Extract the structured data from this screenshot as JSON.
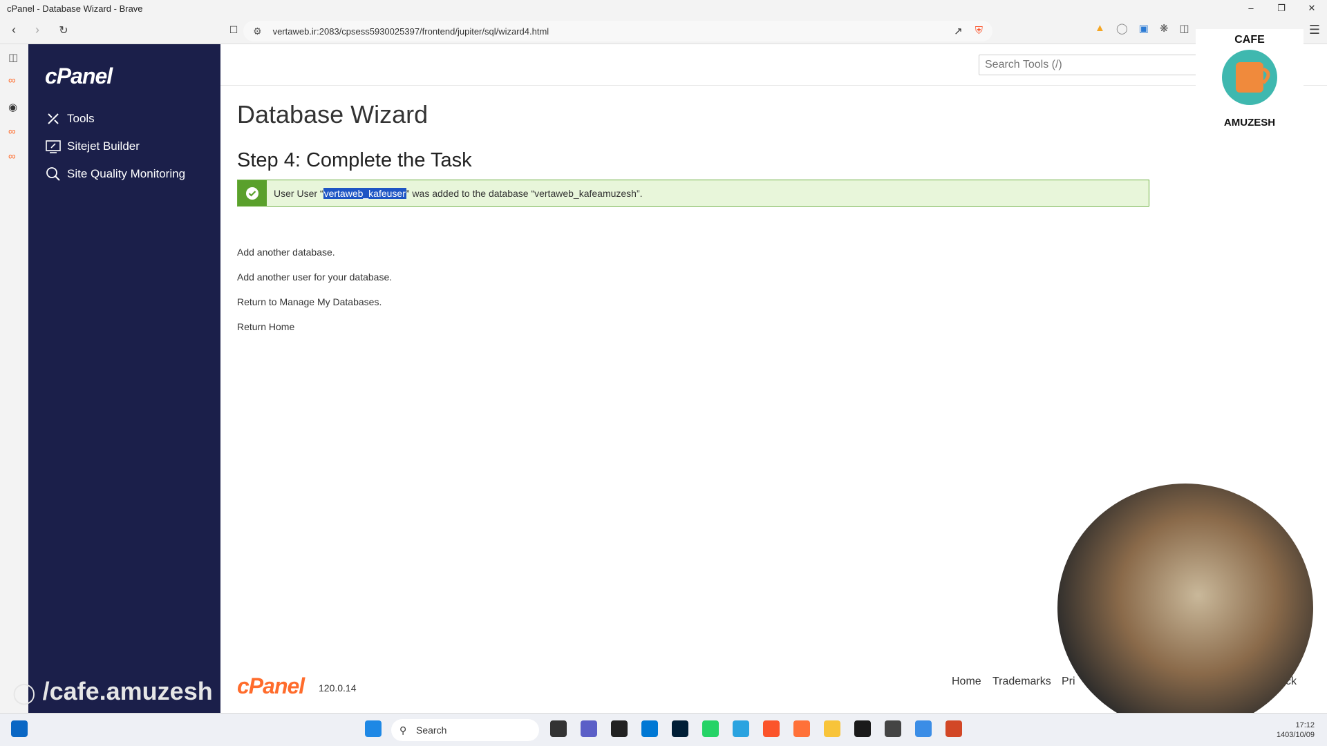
{
  "window": {
    "title": "cPanel - Database Wizard - Brave"
  },
  "browser": {
    "url": "vertaweb.ir:2083/cpsess5930025397/frontend/jupiter/sql/wizard4.html"
  },
  "sidebar": {
    "logo": "cPanel",
    "items": [
      {
        "label": "Tools",
        "icon": "tools-icon"
      },
      {
        "label": "Sitejet Builder",
        "icon": "sitejet-icon"
      },
      {
        "label": "Site Quality Monitoring",
        "icon": "magnifier-icon"
      }
    ]
  },
  "search": {
    "placeholder": "Search Tools (/)"
  },
  "main": {
    "title": "Database Wizard",
    "step_title": "Step 4: Complete the Task",
    "alert": {
      "prefix": "User “",
      "user": "vertaweb_kafeuser",
      "suffix": "” was added to the database “vertaweb_kafeamuzesh”."
    },
    "links": [
      "Add another database.",
      "Add another user for your database.",
      "Return to Manage My Databases.",
      "Return Home"
    ]
  },
  "footer": {
    "logo": "cPanel",
    "version": "120.0.14",
    "links": [
      "Home",
      "Trademarks",
      "Pri",
      "ck"
    ]
  },
  "overlay": {
    "brand_top": "CAFE",
    "brand_bottom": "AMUZESH",
    "watermark": "/cafe.amuzesh"
  },
  "taskbar": {
    "search_label": "Search",
    "time": "17:12",
    "date": "1403/10/09"
  }
}
